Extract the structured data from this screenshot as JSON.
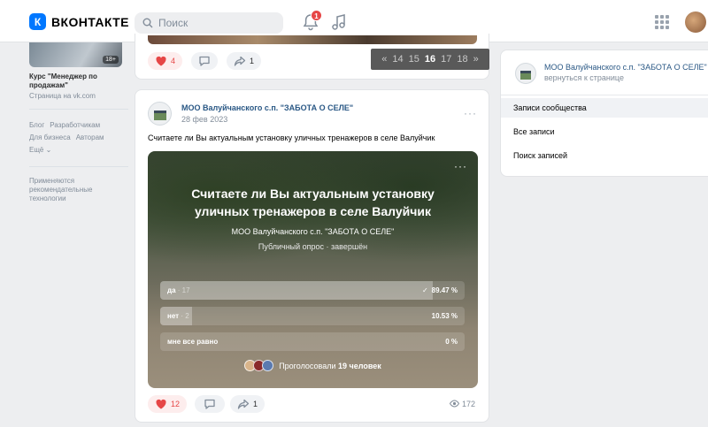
{
  "header": {
    "logo_mark": "К",
    "logo_text": "ВКОНТАКТЕ",
    "search_placeholder": "Поиск",
    "notifications_count": "1"
  },
  "left_menu": {
    "ad_age": "18+",
    "ad_title": "Курс \"Менеджер по продажам\"",
    "ad_subtitle": "Страница на vk.com",
    "links": [
      "Блог",
      "Разработчикам",
      "Для бизнеса",
      "Авторам",
      "Ещё ⌄"
    ],
    "reco_note": "Применяются рекомендательные технологии"
  },
  "prev_post": {
    "likes": "4",
    "shares": "1"
  },
  "pager": {
    "prev": "«",
    "pages": [
      "14",
      "15",
      "16",
      "17",
      "18"
    ],
    "current": "16",
    "next": "»"
  },
  "post": {
    "author": "МОО Валуйчанского с.п. \"ЗАБОТА О СЕЛЕ\"",
    "date": "28 фев 2023",
    "more": "···",
    "text": "Считаете ли Вы актуальным установку уличных тренажеров в селе Валуйчик",
    "likes": "12",
    "shares": "1",
    "views": "172"
  },
  "poll": {
    "dots": "···",
    "question": "Считаете ли Вы актуальным установку уличных тренажеров в селе Валуйчик",
    "author": "МОО Валуйчанского с.п. \"ЗАБОТА О СЕЛЕ\"",
    "status": "Публичный опрос · завершён",
    "options": [
      {
        "label": "да",
        "count": "· 17",
        "percent": "89.47 %",
        "share": 0.8947,
        "check": "✓"
      },
      {
        "label": "нет",
        "count": "· 2",
        "percent": "10.53 %",
        "share": 0.1053,
        "check": ""
      },
      {
        "label": "мне все равно",
        "count": "",
        "percent": "0 %",
        "share": 0,
        "check": ""
      }
    ],
    "voted_prefix": "Проголосовали",
    "voted_count": "19 человек"
  },
  "right_panel": {
    "title": "МОО Валуйчанского с.п. \"ЗАБОТА О СЕЛЕ\"",
    "back": "вернуться к странице",
    "items": [
      {
        "label": "Записи сообщества",
        "active": true
      },
      {
        "label": "Все записи",
        "active": false
      },
      {
        "label": "Поиск записей",
        "active": false
      }
    ]
  },
  "colors": {
    "brand": "#0077ff",
    "like_red": "#e64646",
    "link_blue": "#2a5885"
  }
}
